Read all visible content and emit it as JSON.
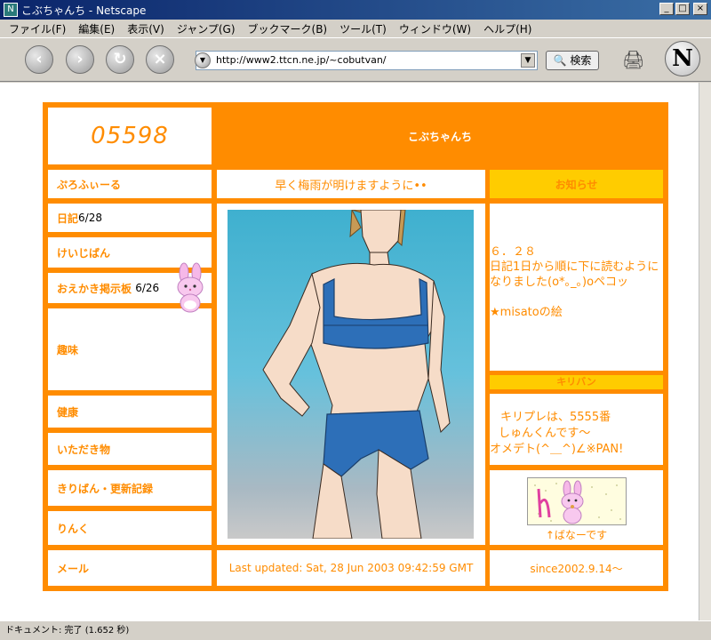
{
  "window": {
    "title": "こぶちゃんち - Netscape",
    "minimize": "_",
    "maximize": "□",
    "close": "×"
  },
  "menu": [
    "ファイル(F)",
    "編集(E)",
    "表示(V)",
    "ジャンプ(G)",
    "ブックマーク(B)",
    "ツール(T)",
    "ウィンドウ(W)",
    "ヘルプ(H)"
  ],
  "toolbar": {
    "url": "http://www2.ttcn.ne.jp/~cobutvan/",
    "search_label": "検索",
    "back_icon": "back-arrow-icon",
    "forward_icon": "forward-arrow-icon",
    "reload_icon": "reload-icon",
    "stop_icon": "stop-icon"
  },
  "page": {
    "counter": "05598",
    "site_title": "こぶちゃんち",
    "message": "早く梅雨が明けますように••",
    "nav": {
      "profile": "ぷろふぃーる",
      "diary": "日記",
      "diary_date": "6/28",
      "bbs": "けいじばん",
      "oekaki": "おえかき掲示板",
      "oekaki_date": "6/26",
      "hobby": "趣味",
      "health": "健康",
      "gifts": "いただき物",
      "kiriban": "きりばん・更新記録",
      "links": "りんく",
      "mail": "メール"
    },
    "notice": {
      "heading": "お知らせ",
      "date": "６．２８",
      "text": "日記1日から順に下に読むようになりました(o*｡_｡)oペコッ",
      "misato": "★misatoの絵"
    },
    "kiriban": {
      "heading": "キリバン",
      "text1": "キリプレは、5555番",
      "text2": "しゅんくんです〜",
      "text3": "オメデト(^＿^)∠※PAN!"
    },
    "banner_caption": "↑ばなーです",
    "last_updated": "Last updated: Sat, 28 Jun 2003 09:42:59 GMT",
    "since": "since2002.9.14〜"
  },
  "status": {
    "text": "ドキュメント: 完了 (1.652 秒)"
  },
  "colors": {
    "accent": "#ff8c00",
    "highlight": "#ffcc00"
  }
}
